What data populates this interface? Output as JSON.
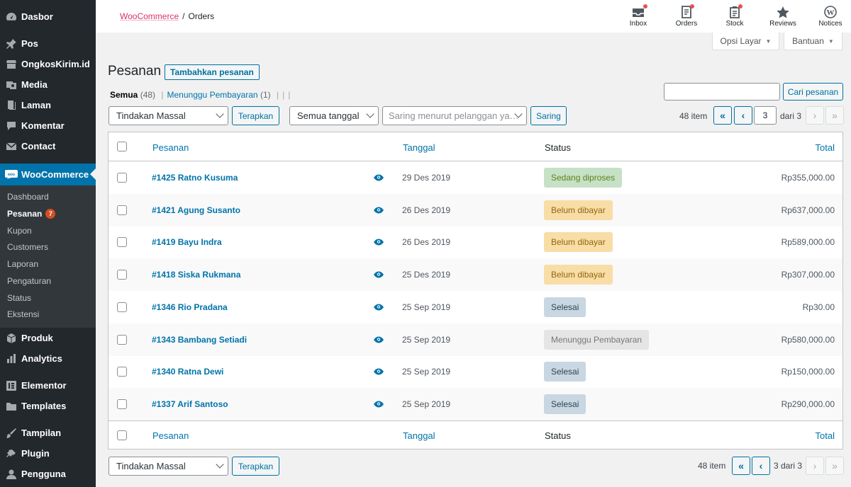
{
  "sidebar": {
    "top_items": [
      {
        "label": "Dasbor",
        "icon": "dashboard-icon"
      },
      {
        "label": "Pos",
        "icon": "pin-icon"
      },
      {
        "label": "OngkosKirim.id",
        "icon": "store-icon"
      },
      {
        "label": "Media",
        "icon": "media-icon"
      },
      {
        "label": "Laman",
        "icon": "page-icon"
      },
      {
        "label": "Komentar",
        "icon": "comment-icon"
      },
      {
        "label": "Contact",
        "icon": "mail-icon"
      },
      {
        "label": "WooCommerce",
        "icon": "woocommerce-icon"
      }
    ],
    "submenu": [
      {
        "label": "Dashboard"
      },
      {
        "label": "Pesanan",
        "badge": "7"
      },
      {
        "label": "Kupon"
      },
      {
        "label": "Customers"
      },
      {
        "label": "Laporan"
      },
      {
        "label": "Pengaturan"
      },
      {
        "label": "Status"
      },
      {
        "label": "Ekstensi"
      }
    ],
    "bottom_items": [
      {
        "label": "Produk",
        "icon": "box-icon"
      },
      {
        "label": "Analytics",
        "icon": "bar-chart-icon"
      },
      {
        "label": "Elementor",
        "icon": "elementor-icon"
      },
      {
        "label": "Templates",
        "icon": "folder-icon"
      },
      {
        "label": "Tampilan",
        "icon": "brush-icon"
      },
      {
        "label": "Plugin",
        "icon": "plug-icon"
      },
      {
        "label": "Pengguna",
        "icon": "user-icon"
      }
    ]
  },
  "header": {
    "breadcrumb_link": "WooCommerce",
    "breadcrumb_sep": "/",
    "breadcrumb_current": "Orders",
    "activity": [
      {
        "label": "Inbox",
        "icon": "inbox-icon",
        "dot": true
      },
      {
        "label": "Orders",
        "icon": "orders-icon",
        "dot": true
      },
      {
        "label": "Stock",
        "icon": "stock-icon",
        "dot": true
      },
      {
        "label": "Reviews",
        "icon": "star-icon",
        "dot": false
      },
      {
        "label": "Notices",
        "icon": "wordpress-icon",
        "dot": false
      }
    ],
    "screen_options": "Opsi Layar",
    "help": "Bantuan"
  },
  "page": {
    "title": "Pesanan",
    "add_button": "Tambahkan pesanan",
    "filter_all": "Semua",
    "filter_all_count": "(48)",
    "filter_pending": "Menunggu Pembayaran",
    "filter_pending_count": "(1)",
    "filter_sep": "|",
    "search_button": "Cari pesanan",
    "bulk_action": "Tindakan Massal",
    "apply": "Terapkan",
    "date_filter": "Semua tanggal",
    "customer_filter": "Saring menurut pelanggan ya…",
    "filter_button": "Saring",
    "items_count": "48 item",
    "current_page": "3",
    "of_pages": "dari 3",
    "bottom_pages": "3 dari 3",
    "first": "«",
    "prev": "‹",
    "next": "›",
    "last": "»"
  },
  "table": {
    "columns": {
      "order": "Pesanan",
      "date": "Tanggal",
      "status": "Status",
      "total": "Total"
    },
    "rows": [
      {
        "order": "#1425 Ratno Kusuma",
        "date": "29 Des 2019",
        "status": "Sedang diproses",
        "status_type": "processing",
        "total": "Rp355,000.00"
      },
      {
        "order": "#1421 Agung Susanto",
        "date": "26 Des 2019",
        "status": "Belum dibayar",
        "status_type": "on-hold",
        "total": "Rp637,000.00"
      },
      {
        "order": "#1419 Bayu Indra",
        "date": "26 Des 2019",
        "status": "Belum dibayar",
        "status_type": "on-hold",
        "total": "Rp589,000.00"
      },
      {
        "order": "#1418 Siska Rukmana",
        "date": "25 Des 2019",
        "status": "Belum dibayar",
        "status_type": "on-hold",
        "total": "Rp307,000.00"
      },
      {
        "order": "#1346 Rio Pradana",
        "date": "25 Sep 2019",
        "status": "Selesai",
        "status_type": "completed",
        "total": "Rp30.00"
      },
      {
        "order": "#1343 Bambang Setiadi",
        "date": "25 Sep 2019",
        "status": "Menunggu Pembayaran",
        "status_type": "pending",
        "total": "Rp580,000.00"
      },
      {
        "order": "#1340 Ratna Dewi",
        "date": "25 Sep 2019",
        "status": "Selesai",
        "status_type": "completed",
        "total": "Rp150,000.00"
      },
      {
        "order": "#1337 Arif Santoso",
        "date": "25 Sep 2019",
        "status": "Selesai",
        "status_type": "completed",
        "total": "Rp290,000.00"
      }
    ]
  },
  "colors": {
    "sidebar_bg": "#23282d",
    "active_menu": "#0073aa",
    "link": "#0073aa",
    "processing_bg": "#c6e1c6",
    "processing_fg": "#5b841b",
    "on_hold_bg": "#f8dda7",
    "on_hold_fg": "#94660c",
    "completed_bg": "#c8d7e1",
    "completed_fg": "#2e4453",
    "pending_bg": "#e5e5e5",
    "pending_fg": "#777777"
  }
}
